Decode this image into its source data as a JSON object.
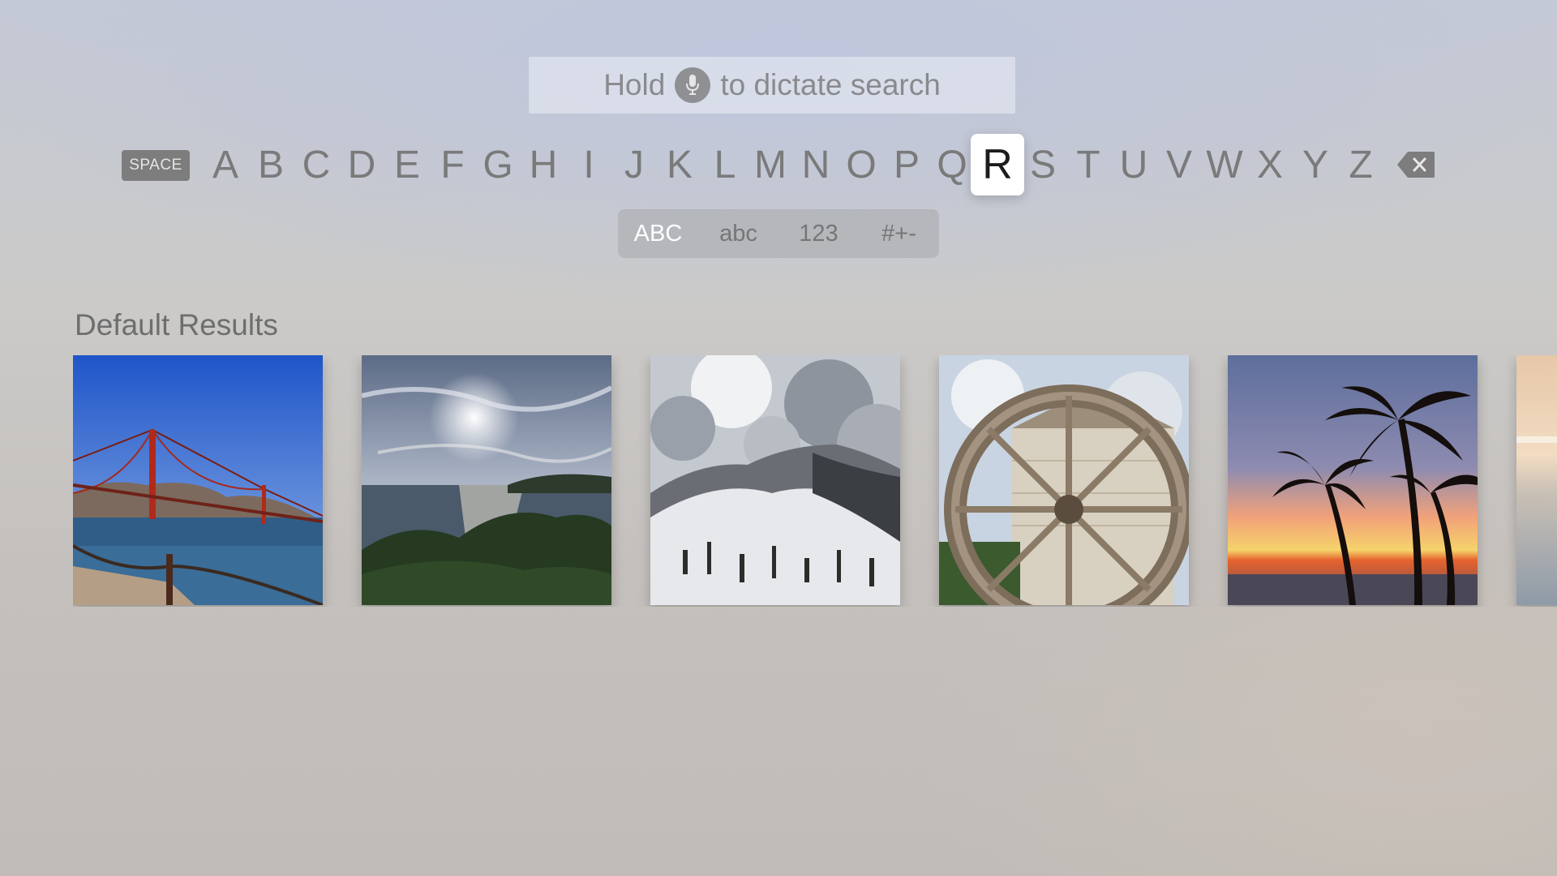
{
  "search": {
    "prefix": "Hold",
    "suffix": "to dictate search",
    "mic_icon": "microphone-icon"
  },
  "keyboard": {
    "space_label": "SPACE",
    "letters": [
      "A",
      "B",
      "C",
      "D",
      "E",
      "F",
      "G",
      "H",
      "I",
      "J",
      "K",
      "L",
      "M",
      "N",
      "O",
      "P",
      "Q",
      "R",
      "S",
      "T",
      "U",
      "V",
      "W",
      "X",
      "Y",
      "Z"
    ],
    "selected_letter": "R",
    "delete_icon": "backspace-icon"
  },
  "modes": {
    "items": [
      "ABC",
      "abc",
      "123",
      "#+-"
    ],
    "active": "ABC"
  },
  "results": {
    "title": "Default Results",
    "photos": [
      {
        "subject": "golden-gate-bridge"
      },
      {
        "subject": "sunset-over-coast"
      },
      {
        "subject": "snowy-mountain"
      },
      {
        "subject": "water-wheel"
      },
      {
        "subject": "palm-trees-sunset"
      },
      {
        "subject": "ocean-partial"
      }
    ]
  },
  "colors": {
    "selected_key_bg": "#ffffff",
    "selected_key_text": "#1c1c1c",
    "key_text": "#7a7a7a",
    "active_mode_text": "#ffffff"
  }
}
